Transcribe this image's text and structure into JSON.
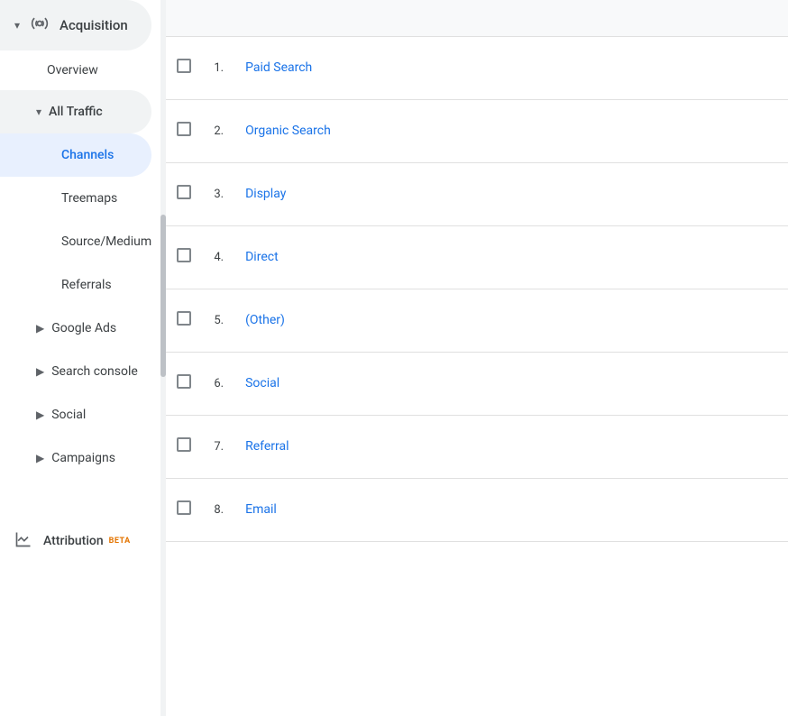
{
  "sidebar": {
    "acquisition_label": "Acquisition",
    "acquisition_icon": "→",
    "overview_label": "Overview",
    "all_traffic_label": "All Traffic",
    "channels_label": "Channels",
    "treemaps_label": "Treemaps",
    "source_medium_label": "Source/Medium",
    "referrals_label": "Referrals",
    "google_ads_label": "Google Ads",
    "search_console_label": "Search console",
    "social_label": "Social",
    "campaigns_label": "Campaigns",
    "attribution_label": "Attribution",
    "beta_label": "BETA"
  },
  "table": {
    "header_checkbox": "",
    "rows": [
      {
        "number": "1.",
        "channel": "Paid Search"
      },
      {
        "number": "2.",
        "channel": "Organic Search"
      },
      {
        "number": "3.",
        "channel": "Display"
      },
      {
        "number": "4.",
        "channel": "Direct"
      },
      {
        "number": "5.",
        "channel": "(Other)"
      },
      {
        "number": "6.",
        "channel": "Social"
      },
      {
        "number": "7.",
        "channel": "Referral"
      },
      {
        "number": "8.",
        "channel": "Email"
      }
    ]
  },
  "colors": {
    "active_bg": "#e8f0fe",
    "active_text": "#1a73e8",
    "hover_bg": "#f1f3f4",
    "link_color": "#1a73e8",
    "beta_color": "#e37400",
    "border_color": "#e0e0e0",
    "text_primary": "#3c4043",
    "text_secondary": "#5f6368"
  }
}
